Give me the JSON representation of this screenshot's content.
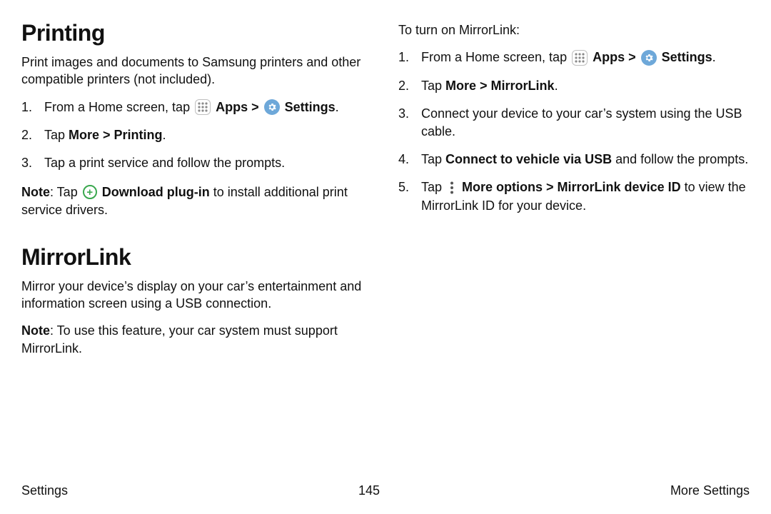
{
  "left": {
    "printing": {
      "heading": "Printing",
      "intro": "Print images and documents to Samsung printers and other compatible printers (not included).",
      "steps": {
        "s1_pre": "From a Home screen, tap ",
        "s1_apps": "Apps",
        "s1_sep": " > ",
        "s1_settings": "Settings",
        "s1_post": ".",
        "s2_pre": "Tap ",
        "s2_bold": "More > Printing",
        "s2_post": ".",
        "s3": "Tap a print service and follow the prompts."
      },
      "note": {
        "label": "Note",
        "pre": ": Tap ",
        "bold": "Download plug-in",
        "post": " to install additional print service drivers."
      }
    },
    "mirrorlink": {
      "heading": "MirrorLink",
      "intro": "Mirror your device’s display on your car’s entertainment and information screen using a USB connection.",
      "note": {
        "label": "Note",
        "post": ": To use this feature, your car system must support MirrorLink."
      }
    }
  },
  "right": {
    "lead": "To turn on MirrorLink:",
    "steps": {
      "s1_pre": "From a Home screen, tap ",
      "s1_apps": "Apps",
      "s1_sep": " > ",
      "s1_settings": "Settings",
      "s1_post": ".",
      "s2_pre": "Tap ",
      "s2_bold": "More > MirrorLink",
      "s2_post": ".",
      "s3": "Connect your device to your car’s system using the USB cable.",
      "s4_pre": "Tap ",
      "s4_bold": "Connect to vehicle via USB",
      "s4_post": " and follow the prompts.",
      "s5_pre": "Tap ",
      "s5_bold": "More options > MirrorLink device ID",
      "s5_post": " to view the MirrorLink ID for your device."
    }
  },
  "footer": {
    "left": "Settings",
    "center": "145",
    "right": "More Settings"
  }
}
